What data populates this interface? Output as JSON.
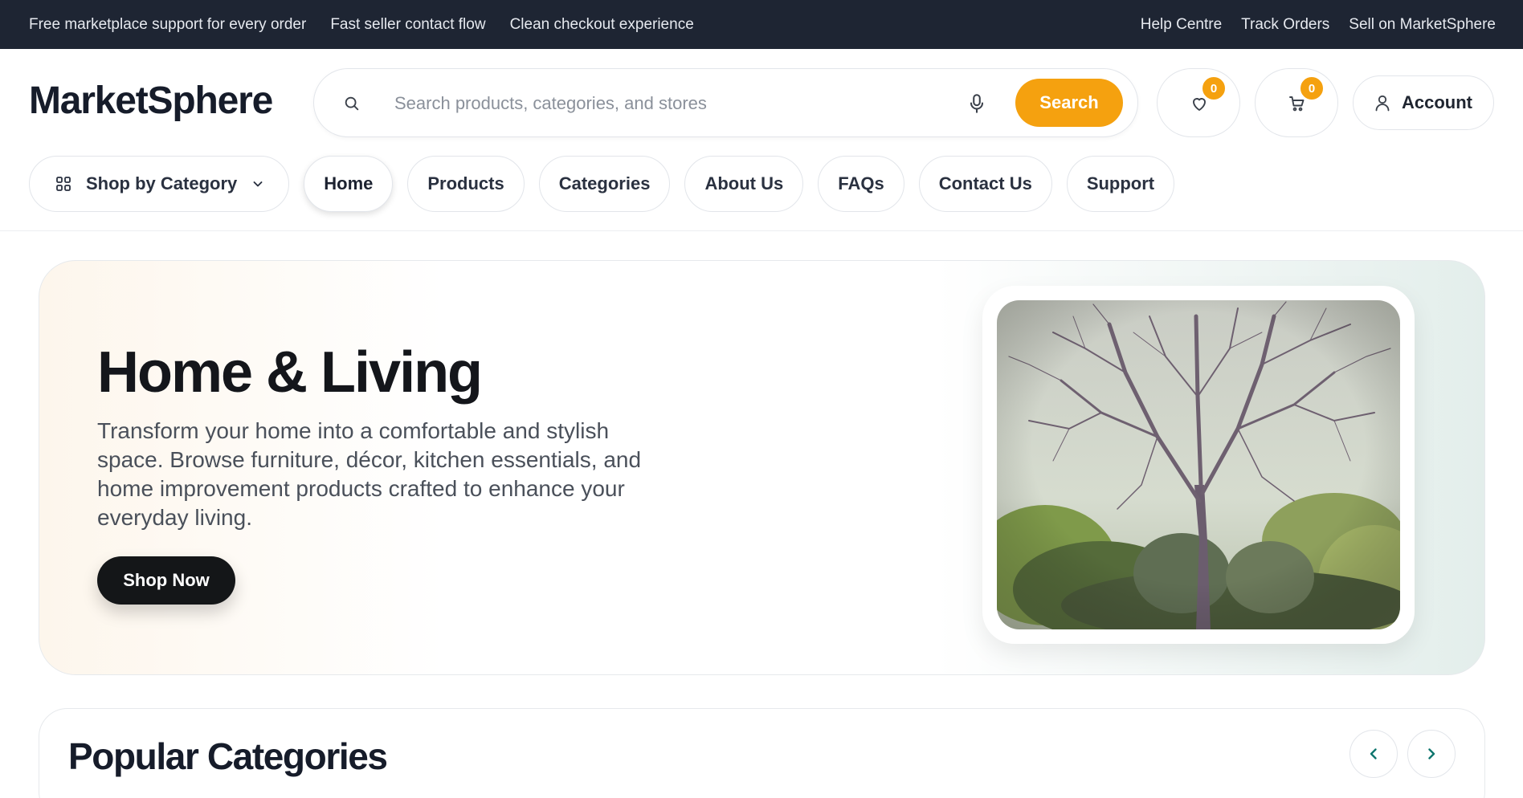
{
  "topbar": {
    "left": [
      "Free marketplace support for every order",
      "Fast seller contact flow",
      "Clean checkout experience"
    ],
    "right": [
      "Help Centre",
      "Track Orders",
      "Sell on MarketSphere"
    ]
  },
  "header": {
    "logo": "MarketSphere",
    "search_placeholder": "Search products, categories, and stores",
    "search_button": "Search",
    "wishlist_count": "0",
    "cart_count": "0",
    "account_label": "Account"
  },
  "nav": {
    "category_button": "Shop by Category",
    "items": [
      "Home",
      "Products",
      "Categories",
      "About Us",
      "FAQs",
      "Contact Us",
      "Support"
    ],
    "active": "Home"
  },
  "hero": {
    "title": "Home & Living",
    "description": "Transform your home into a comfortable and stylish space. Browse furniture, décor, kitchen essentials, and home improvement products crafted to enhance your everyday living.",
    "button": "Shop Now"
  },
  "popular": {
    "title": "Popular Categories"
  },
  "colors": {
    "topbar": "#1e2533",
    "accent": "#f5a10f",
    "dark_button": "#141618",
    "arrow": "#0f766e"
  },
  "icons": {
    "search": "search-icon",
    "mic": "microphone-icon",
    "wishlist": "heart-icon",
    "cart": "cart-icon",
    "account": "user-icon",
    "category": "grid-icon",
    "chevron": "chevron-down-icon",
    "prev": "chevron-left-icon",
    "next": "chevron-right-icon"
  }
}
